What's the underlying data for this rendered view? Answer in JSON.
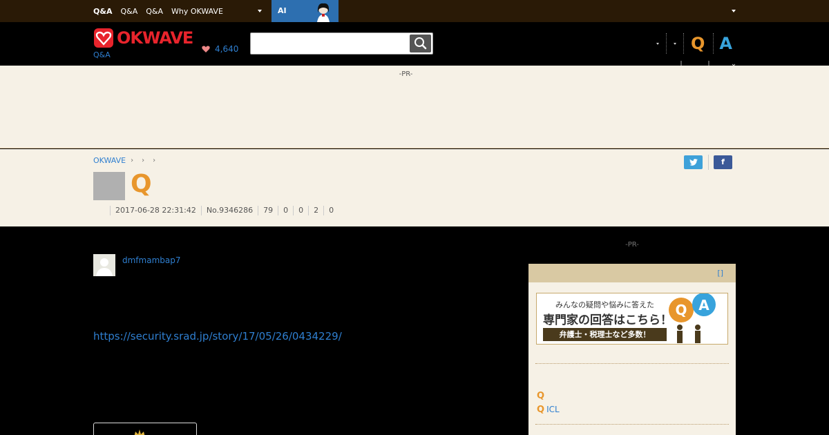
{
  "topnav": {
    "items": [
      "Q&A",
      "Q&A",
      "Q&A",
      "Why OKWAVE"
    ],
    "ai_label": "AI"
  },
  "header": {
    "logo_text": "OKWAVE",
    "logo_sub": "Q&A",
    "points": "4,640",
    "search_placeholder": "",
    "q_label": "Q",
    "a_label": "A"
  },
  "pr": {
    "label": "-PR-"
  },
  "question": {
    "breadcrumb": [
      "OKWAVE"
    ],
    "title": "Q",
    "date": "2017-06-28 22:31:42",
    "number": "No.9346286",
    "views": "79",
    "stat1": "0",
    "stat2": "0",
    "stat3": "2",
    "stat4": "0"
  },
  "share": {
    "twitter_icon": "twitter-icon",
    "facebook_label": "f"
  },
  "post": {
    "username": "dmfmambap7",
    "link": "https://security.srad.jp/story/17/05/26/0434229/"
  },
  "sidebar": {
    "pr_label": "-PR-",
    "head_bracket": "[]",
    "banner": {
      "line1": "みんなの疑問や悩みに答えた",
      "line2": "専門家の回答はこちら！",
      "line3": "弁護士・税理士など多数！",
      "q": "Q",
      "a": "A"
    },
    "questions": [
      {
        "q": "Q",
        "text": ""
      },
      {
        "q": "Q",
        "text": "ICL"
      }
    ]
  },
  "colors": {
    "topbar": "#2a1a06",
    "brand_red": "#e8242c",
    "link_blue": "#2f7fd0",
    "q_orange": "#e8962c",
    "a_blue": "#38a3dc",
    "cream": "#f6f1e6"
  }
}
